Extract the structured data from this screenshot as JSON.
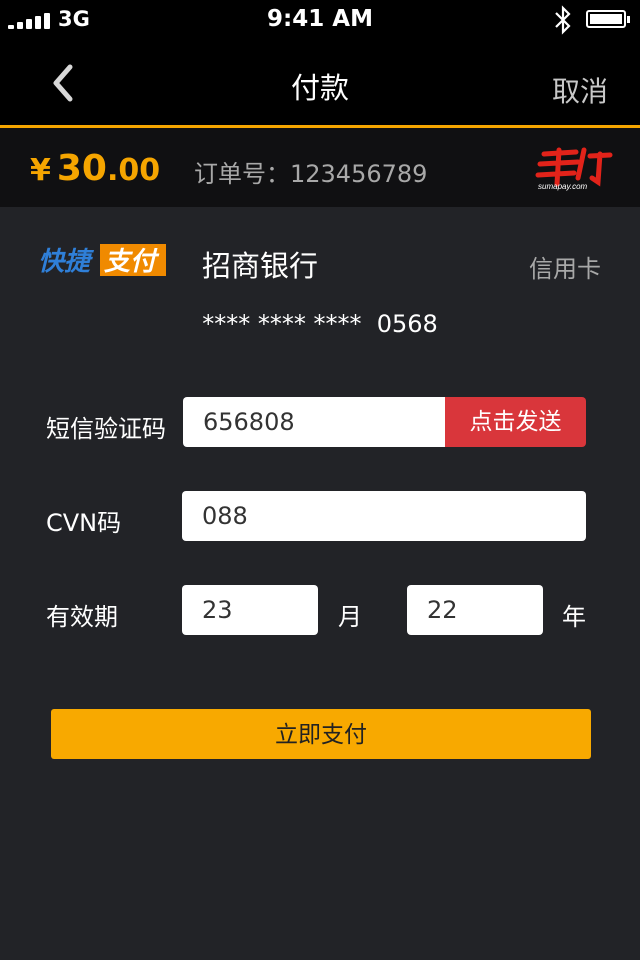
{
  "status_bar": {
    "network": "3G",
    "time": "9:41 AM"
  },
  "nav": {
    "title": "付款",
    "cancel_label": "取消"
  },
  "order": {
    "currency": "¥",
    "amount_int": "30",
    "amount_dec": ".00",
    "order_number": "订单号：123456789",
    "logo_text": "sumapay.com"
  },
  "card": {
    "quickpay_logo_a": "快捷",
    "quickpay_logo_b": "支付",
    "bank_name": "招商银行",
    "card_type": "信用卡",
    "card_number": "**** **** ****  0568"
  },
  "form": {
    "sms_label": "短信验证码",
    "sms_value": "656808",
    "send_button": "点击发送",
    "cvn_label": "CVN码",
    "cvn_value": "088",
    "expiry_label": "有效期",
    "month_value": "23",
    "month_unit": "月",
    "year_value": "22",
    "year_unit": "年"
  },
  "pay_button": "立即支付",
  "colors": {
    "accent": "#f5a500",
    "send_button": "#d9363b",
    "background": "#222327"
  },
  "icons": [
    "signal-icon",
    "bluetooth-icon",
    "battery-icon",
    "back-chevron-icon"
  ]
}
